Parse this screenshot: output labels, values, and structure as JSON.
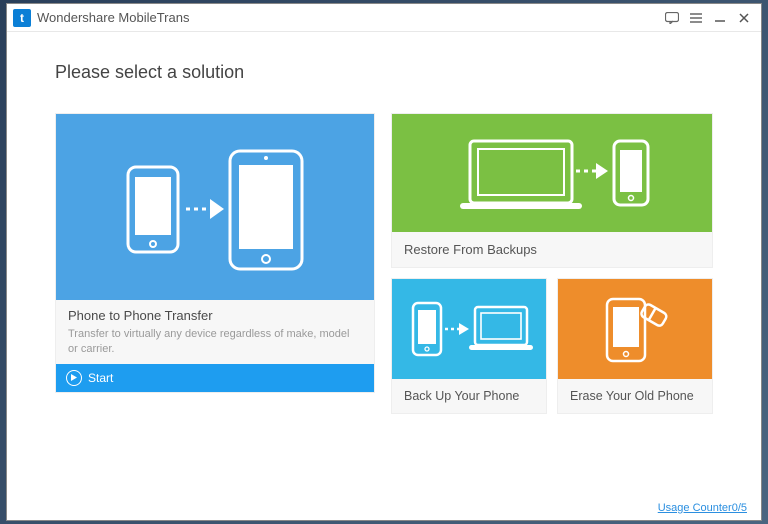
{
  "app": {
    "logoLetter": "t",
    "title": "Wondershare MobileTrans"
  },
  "heading": "Please select a solution",
  "tiles": {
    "main": {
      "title": "Phone to Phone Transfer",
      "desc": "Transfer to virtually any device regardless of make, model or carrier.",
      "startLabel": "Start"
    },
    "restore": {
      "title": "Restore From Backups"
    },
    "backup": {
      "title": "Back Up Your Phone"
    },
    "erase": {
      "title": "Erase Your Old Phone"
    }
  },
  "footer": {
    "usage": "Usage Counter0/5"
  }
}
